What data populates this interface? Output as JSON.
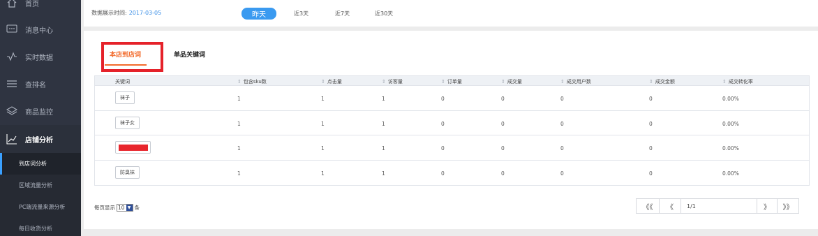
{
  "sidebar": {
    "items": [
      {
        "label": "首页",
        "icon": "home-icon"
      },
      {
        "label": "消息中心",
        "icon": "message-icon"
      },
      {
        "label": "实时数据",
        "icon": "pulse-icon"
      },
      {
        "label": "查排名",
        "icon": "menu-icon"
      },
      {
        "label": "商品监控",
        "icon": "layers-icon"
      },
      {
        "label": "店铺分析",
        "icon": "chart-icon"
      }
    ],
    "sub_items": [
      {
        "label": "到店词分析"
      },
      {
        "label": "区域流量分析"
      },
      {
        "label": "PC端流量来源分析"
      },
      {
        "label": "每日收货分析"
      }
    ]
  },
  "topbar": {
    "date_label": "数据展示时间:",
    "date_value": "2017-03-05",
    "periods": [
      "昨天",
      "近3天",
      "近7天",
      "近30天"
    ],
    "active_period": "昨天"
  },
  "tabs": [
    "本店到店词",
    "单品关键词"
  ],
  "table": {
    "columns": [
      "关键词",
      "包含sku数",
      "点击量",
      "访客量",
      "订单量",
      "成交量",
      "成交用户数",
      "成交金额",
      "成交转化率"
    ],
    "rows": [
      {
        "keyword": "袜子",
        "sku": "1",
        "clicks": "1",
        "visitors": "1",
        "orders": "0",
        "deals": "0",
        "buyers": "0",
        "amount": "0",
        "rate": "0.00%"
      },
      {
        "keyword": "袜子女",
        "sku": "1",
        "clicks": "1",
        "visitors": "1",
        "orders": "0",
        "deals": "0",
        "buyers": "0",
        "amount": "0",
        "rate": "0.00%"
      },
      {
        "keyword": "",
        "sku": "1",
        "clicks": "1",
        "visitors": "1",
        "orders": "0",
        "deals": "0",
        "buyers": "0",
        "amount": "0",
        "rate": "0.00%"
      },
      {
        "keyword": "防臭袜",
        "sku": "1",
        "clicks": "1",
        "visitors": "1",
        "orders": "0",
        "deals": "0",
        "buyers": "0",
        "amount": "0",
        "rate": "0.00%"
      }
    ]
  },
  "footer": {
    "per_page_prefix": "每页显示",
    "per_page_value": "10",
    "per_page_suffix": "条",
    "pager_first": "《《",
    "pager_prev": "《",
    "pager_info": "1/1",
    "pager_next": "》",
    "pager_last": "》》"
  },
  "colors": {
    "sidebar_bg": "#2f3441",
    "accent": "#3a9af0",
    "tab_active": "#f26b2c",
    "highlight": "#e5222a"
  }
}
